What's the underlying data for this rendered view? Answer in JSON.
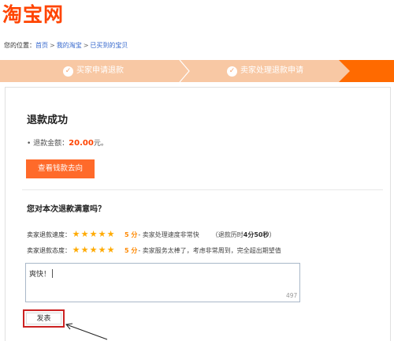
{
  "logo": {
    "text": "淘宝网"
  },
  "breadcrumb": {
    "prefix": "您的位置：",
    "items": [
      "首页",
      "我的淘宝",
      "已买到的宝贝"
    ],
    "separator": ">"
  },
  "steps": [
    {
      "label": "买家申请退款",
      "icon": "check-circle-icon"
    },
    {
      "label": "卖家处理退款申请",
      "icon": "check-circle-icon"
    }
  ],
  "result": {
    "title": "退款成功",
    "amount_prefix": "• 退款金额：",
    "amount_value": "20.00",
    "amount_unit": "元。",
    "view_button": "查看钱款去向"
  },
  "survey": {
    "question": "您对本次退款满意吗？",
    "ratings": [
      {
        "label": "卖家退款速度：",
        "stars": 5,
        "score": "5 分",
        "desc": "- 卖家处理速度非常快",
        "extra_prefix": "（退款历时",
        "extra_value": "4分50秒",
        "extra_suffix": "）"
      },
      {
        "label": "卖家退款态度：",
        "stars": 5,
        "score": "5 分",
        "desc": "- 卖家服务太棒了，考虑非常周到，完全超出期望值"
      }
    ],
    "comment_value": "爽快！",
    "char_counter": "497",
    "submit_button": "发表"
  },
  "colors": {
    "brand": "#ff4400",
    "step_bg": "#f8c8a4",
    "step_active": "#ff6a00",
    "star": "#ffaa00",
    "highlight_border": "#cc2222"
  }
}
